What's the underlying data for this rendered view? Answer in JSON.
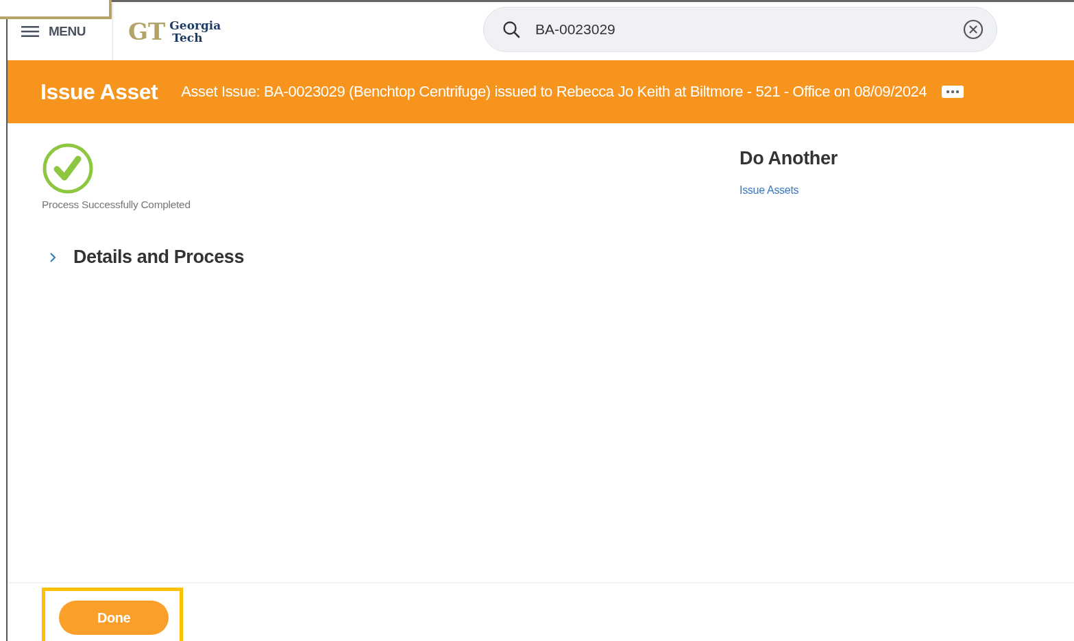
{
  "header": {
    "menu_label": "MENU",
    "logo": {
      "monogram": "GT",
      "name_lines": [
        "Georgia",
        "Tech"
      ]
    },
    "search": {
      "value": "BA-0023029"
    }
  },
  "banner": {
    "title": "Issue Asset",
    "subtitle": "Asset Issue: BA-0023029 (Benchtop Centrifuge) issued to Rebecca Jo Keith at Biltmore - 521 - Office on 08/09/2024"
  },
  "status": {
    "message": "Process Successfully Completed"
  },
  "do_another": {
    "heading": "Do Another",
    "links": [
      "Issue Assets"
    ]
  },
  "details": {
    "label": "Details and Process",
    "expanded": false
  },
  "footer": {
    "button": "Done",
    "highlighted": true
  },
  "annotations": [
    {
      "kind": "corner-frame",
      "color": "#b5a36a"
    }
  ]
}
